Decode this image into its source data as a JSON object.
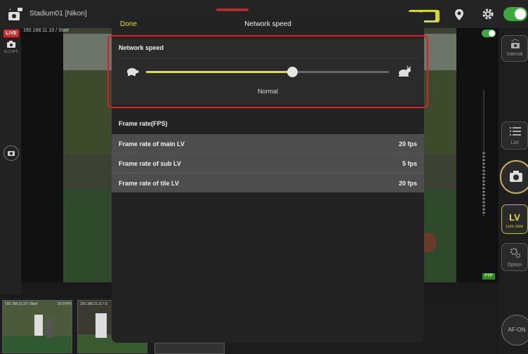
{
  "app": {
    "title": "Stadium01 [Nikon]"
  },
  "live_view": {
    "ip_status": "192.168.11.10 / Start",
    "live_badge": "LIVE",
    "left_fps": "16.3 FPS",
    "ftp_badge": "FTP"
  },
  "right_panel": {
    "interval_label": "Interval",
    "list_label": "List",
    "lv_label": "LV",
    "lv_sublabel": "Live view",
    "option_label": "Option",
    "afon_label": "AF-ON"
  },
  "thumbnails": [
    {
      "caption": "192.168.11.10 / Start",
      "fps": "20.0 FPS"
    },
    {
      "caption": "192.168.11.11 / S"
    }
  ],
  "modal": {
    "done_label": "Done",
    "title": "Network speed",
    "network_speed": {
      "heading": "Network speed",
      "value_label": "Normal",
      "slider_level": 0.6
    },
    "frame_rate": {
      "heading": "Frame rate(FPS)",
      "rows": [
        {
          "name": "Frame rate of main LV",
          "value": "20 fps"
        },
        {
          "name": "Frame rate of sub LV",
          "value": "5 fps"
        },
        {
          "name": "Frame rate of tile LV",
          "value": "20 fps"
        }
      ]
    }
  },
  "colors": {
    "accent_yellow": "#e3e32d",
    "highlight_red": "#d8202a",
    "toggle_green": "#3da93d"
  }
}
